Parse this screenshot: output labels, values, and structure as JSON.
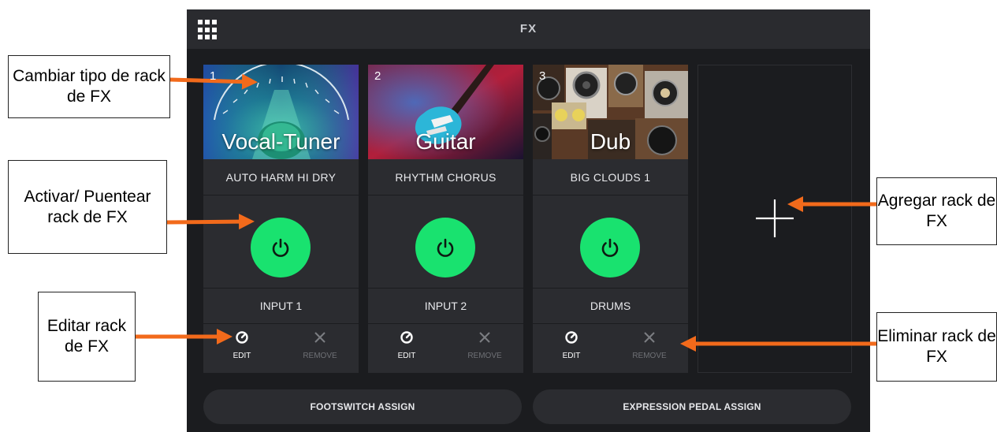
{
  "header": {
    "title": "FX"
  },
  "racks": [
    {
      "number": "1",
      "name": "Vocal-Tuner",
      "preset": "AUTO HARM HI DRY",
      "input": "INPUT 1",
      "edit_label": "EDIT",
      "remove_label": "REMOVE",
      "power_color": "#19e26f"
    },
    {
      "number": "2",
      "name": "Guitar",
      "preset": "RHYTHM CHORUS",
      "input": "INPUT 2",
      "edit_label": "EDIT",
      "remove_label": "REMOVE",
      "power_color": "#19e26f"
    },
    {
      "number": "3",
      "name": "Dub",
      "preset": "BIG CLOUDS 1",
      "input": "DRUMS",
      "edit_label": "EDIT",
      "remove_label": "REMOVE",
      "power_color": "#19e26f"
    }
  ],
  "bottom": {
    "footswitch_label": "FOOTSWITCH ASSIGN",
    "expression_label": "EXPRESSION PEDAL ASSIGN"
  },
  "callouts": {
    "change_type": "Cambiar tipo de rack de FX",
    "activate": "Activar/ Puentear rack de FX",
    "edit": "Editar rack de FX",
    "add": "Agregar rack de FX",
    "remove": "Eliminar rack de FX"
  },
  "colors": {
    "accent_green": "#19e26f",
    "arrow_orange": "#f26a1b",
    "background": "#1b1c1f",
    "panel": "#2b2c30"
  },
  "icons": [
    "grid-menu-icon",
    "power-icon",
    "edit-knob-icon",
    "close-icon",
    "plus-icon"
  ]
}
